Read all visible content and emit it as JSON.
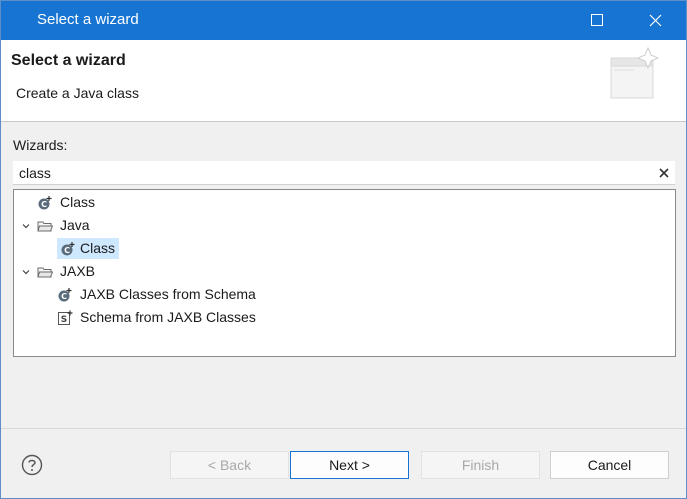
{
  "window": {
    "title": "Select a wizard",
    "controls": [
      "maximize-icon",
      "close-icon"
    ]
  },
  "header": {
    "title": "Select a wizard",
    "description": "Create a Java class",
    "banner_icon": "new-wizard-banner-icon"
  },
  "wizards": {
    "label": "Wizards:",
    "filter_value": "class",
    "clear_icon": "clear-icon",
    "tree": [
      {
        "label": "Class",
        "icon": "java-class-wizard-icon",
        "expanded": null,
        "selected": false,
        "level": 0
      },
      {
        "label": "Java",
        "icon": "folder-open-icon",
        "expanded": true,
        "selected": false,
        "level": 0
      },
      {
        "label": "Class",
        "icon": "java-class-wizard-icon",
        "expanded": null,
        "selected": true,
        "level": 1
      },
      {
        "label": "JAXB",
        "icon": "folder-open-icon",
        "expanded": true,
        "selected": false,
        "level": 0
      },
      {
        "label": "JAXB Classes from Schema",
        "icon": "java-class-wizard-icon",
        "expanded": null,
        "selected": false,
        "level": 1
      },
      {
        "label": "Schema from JAXB Classes",
        "icon": "schema-wizard-icon",
        "expanded": null,
        "selected": false,
        "level": 1
      }
    ]
  },
  "footer": {
    "help_icon": "help-icon",
    "back_label": "< Back",
    "next_label": "Next >",
    "finish_label": "Finish",
    "cancel_label": "Cancel"
  },
  "colors": {
    "titlebar": "#1874d3",
    "selection": "#cde8ff",
    "default_button_border": "#1874d3"
  }
}
